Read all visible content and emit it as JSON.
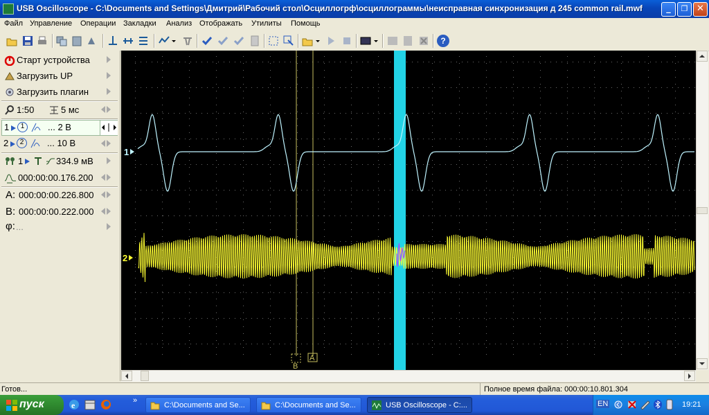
{
  "window": {
    "title": "USB Oscilloscope - C:\\Documents and Settings\\Дмитрий\\Рабочий стол\\Осциллогрф\\осциллограммы\\неисправная синхронизация д 245 common rail.mwf",
    "minimize_glyph": "_",
    "maximize_glyph": "❐",
    "close_glyph": "✕"
  },
  "menu": [
    "Файл",
    "Управление",
    "Операции",
    "Закладки",
    "Анализ",
    "Отображать",
    "Утилиты",
    "Помощь"
  ],
  "toolbar": {
    "icons": [
      "open-icon",
      "save-icon",
      "print-icon",
      "copy-icon",
      "paste-icon",
      "export-icon",
      "cursor-icon",
      "measure-icon",
      "filter-icon",
      "zoom-icon",
      "delete-icon",
      "check-icon",
      "check-all-icon",
      "check-down-icon",
      "page-icon",
      "select-icon",
      "select-area-icon",
      "load-icon",
      "play-icon",
      "stop-icon",
      "display-icon",
      "chart-icon",
      "table-icon",
      "cancel-icon",
      "help-icon"
    ],
    "help_glyph": "?"
  },
  "left_panel": {
    "start_device": "Старт устройства",
    "load_up": "Загрузить UP",
    "load_plugin": "Загрузить плагин",
    "timebase_ratio": "1:50",
    "timebase_div": "5 мс",
    "ch1_num": "1",
    "ch1_circle": "1",
    "ch1_scale": "... 2 В",
    "ch2_num": "2",
    "ch2_circle": "2",
    "ch2_scale": "... 10 В",
    "trigger_channel": "1",
    "trigger_level": "334.9 мВ",
    "trigger_time": "000:00:00.176.200",
    "cursor_a_label": "A:",
    "cursor_a_time": "000:00:00.226.800",
    "cursor_b_label": "B:",
    "cursor_b_time": "000:00:00.222.000",
    "phi_label": "φ:",
    "phi_value": "..."
  },
  "scope": {
    "ch1_marker": "1",
    "ch2_marker": "2",
    "cursor_b_tag": "B",
    "cursor_a_tag": "A",
    "colors": {
      "background": "#000000",
      "grid": "#6b6b6b",
      "ch1": "#bff4ff",
      "ch2": "#ffff33",
      "highlight": "#22d3e6",
      "cursor": "#c8c060"
    }
  },
  "status": {
    "left": "Готов...",
    "right": "Полное время файла: 000:00:10.801.304"
  },
  "taskbar": {
    "start": "пуск",
    "tasks": [
      "C:\\Documents and Se...",
      "C:\\Documents and Se...",
      "USB Oscilloscope - C:..."
    ],
    "lang": "EN",
    "time": "19:21",
    "overflow": "»"
  }
}
